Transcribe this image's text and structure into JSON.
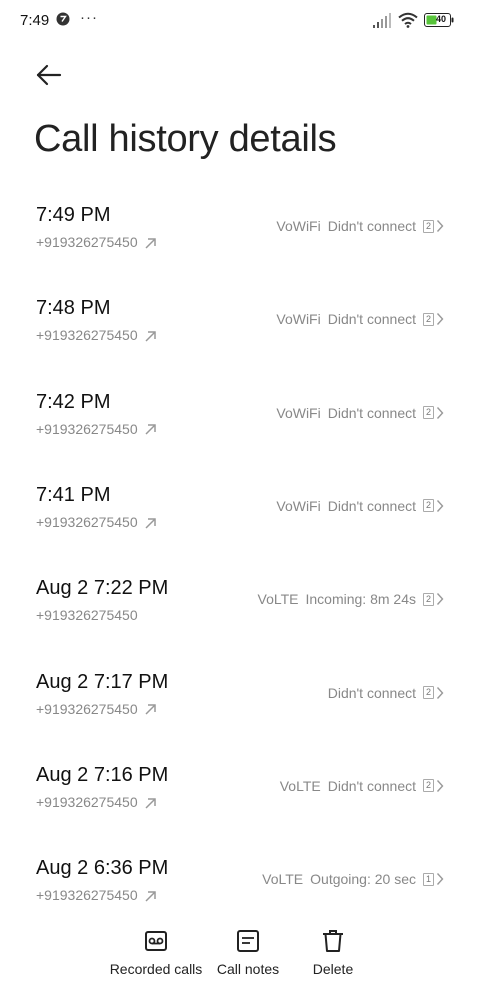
{
  "status_bar": {
    "time": "7:49",
    "dots": "···",
    "battery": "40"
  },
  "header": {
    "title": "Call history details"
  },
  "calls": [
    {
      "time": "7:49 PM",
      "number": "+919326275450",
      "network": "VoWiFi",
      "status": "Didn't connect",
      "sim": "2",
      "outgoing_arrow": true
    },
    {
      "time": "7:48 PM",
      "number": "+919326275450",
      "network": "VoWiFi",
      "status": "Didn't connect",
      "sim": "2",
      "outgoing_arrow": true
    },
    {
      "time": "7:42 PM",
      "number": "+919326275450",
      "network": "VoWiFi",
      "status": "Didn't connect",
      "sim": "2",
      "outgoing_arrow": true
    },
    {
      "time": "7:41 PM",
      "number": "+919326275450",
      "network": "VoWiFi",
      "status": "Didn't connect",
      "sim": "2",
      "outgoing_arrow": true
    },
    {
      "time": "Aug 2 7:22 PM",
      "number": "+919326275450",
      "network": "VoLTE",
      "status": "Incoming: 8m 24s",
      "sim": "2",
      "outgoing_arrow": false
    },
    {
      "time": "Aug 2 7:17 PM",
      "number": "+919326275450",
      "network": "",
      "status": "Didn't connect",
      "sim": "2",
      "outgoing_arrow": true
    },
    {
      "time": "Aug 2 7:16 PM",
      "number": "+919326275450",
      "network": "VoLTE",
      "status": "Didn't connect",
      "sim": "2",
      "outgoing_arrow": true
    },
    {
      "time": "Aug 2 6:36 PM",
      "number": "+919326275450",
      "network": "VoLTE",
      "status": "Outgoing: 20 sec",
      "sim": "1",
      "outgoing_arrow": true
    }
  ],
  "bottom_bar": {
    "recorded_calls": "Recorded calls",
    "call_notes": "Call notes",
    "delete": "Delete"
  },
  "icons": {
    "back": "arrow-left-icon",
    "outgoing": "outgoing-arrow-icon",
    "chevron": "chevron-right-icon",
    "recorded": "voicemail-tape-icon",
    "notes": "note-icon",
    "delete": "trash-icon"
  },
  "colors": {
    "text_primary": "#111111",
    "text_secondary": "#888888",
    "background": "#ffffff"
  }
}
